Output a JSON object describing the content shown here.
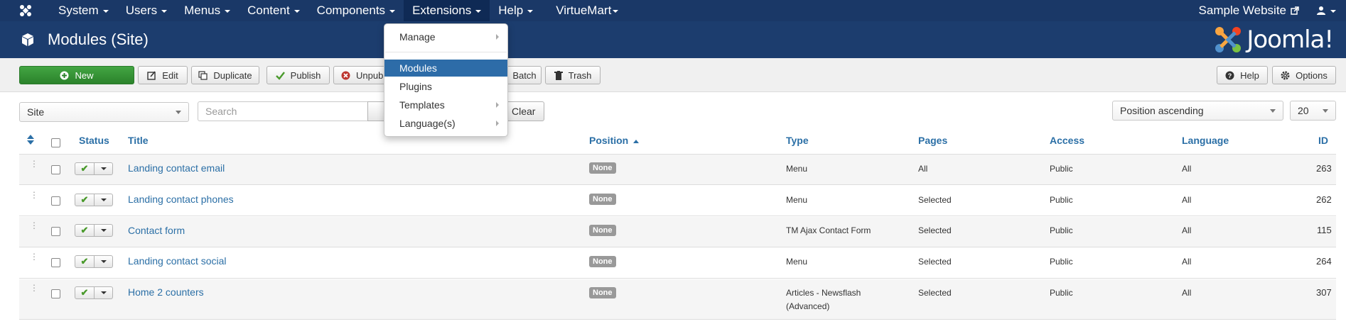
{
  "navbar": {
    "items": [
      {
        "label": "System",
        "has_caret": true
      },
      {
        "label": "Users",
        "has_caret": true
      },
      {
        "label": "Menus",
        "has_caret": true
      },
      {
        "label": "Content",
        "has_caret": true
      },
      {
        "label": "Components",
        "has_caret": true
      },
      {
        "label": "Extensions",
        "has_caret": true
      },
      {
        "label": "Help",
        "has_caret": true
      },
      {
        "label": "VirtueMart",
        "has_caret": true
      }
    ],
    "site_link": "Sample Website"
  },
  "header": {
    "title": "Modules (Site)",
    "logo_text": "Joomla!"
  },
  "toolbar": {
    "new_label": "New",
    "edit_label": "Edit",
    "duplicate_label": "Duplicate",
    "publish_label": "Publish",
    "unpublish_label": "Unpubl",
    "batch_label": "Batch",
    "trash_label": "Trash",
    "help_label": "Help",
    "options_label": "Options"
  },
  "filters": {
    "client_select": "Site",
    "search_placeholder": "Search",
    "clear_label": "Clear",
    "sort_select": "Position ascending",
    "limit_select": "20"
  },
  "dropdown": {
    "items": [
      {
        "label": "Manage",
        "has_submenu": true
      },
      {
        "label": "Modules",
        "has_submenu": false,
        "active": true
      },
      {
        "label": "Plugins",
        "has_submenu": false
      },
      {
        "label": "Templates",
        "has_submenu": true
      },
      {
        "label": "Language(s)",
        "has_submenu": true
      }
    ]
  },
  "table": {
    "headers": {
      "status": "Status",
      "title": "Title",
      "position": "Position",
      "type": "Type",
      "pages": "Pages",
      "access": "Access",
      "language": "Language",
      "id": "ID"
    },
    "rows": [
      {
        "title": "Landing contact email",
        "position": "None",
        "type": "Menu",
        "type2": "",
        "pages": "All",
        "access": "Public",
        "language": "All",
        "id": "263"
      },
      {
        "title": "Landing contact phones",
        "position": "None",
        "type": "Menu",
        "type2": "",
        "pages": "Selected",
        "access": "Public",
        "language": "All",
        "id": "262"
      },
      {
        "title": "Contact form",
        "position": "None",
        "type": "TM Ajax Contact Form",
        "type2": "",
        "pages": "Selected",
        "access": "Public",
        "language": "All",
        "id": "115"
      },
      {
        "title": "Landing contact social",
        "position": "None",
        "type": "Menu",
        "type2": "",
        "pages": "Selected",
        "access": "Public",
        "language": "All",
        "id": "264"
      },
      {
        "title": "Home 2 counters",
        "position": "None",
        "type": "Articles - Newsflash",
        "type2": "(Advanced)",
        "pages": "Selected",
        "access": "Public",
        "language": "All",
        "id": "307"
      }
    ]
  },
  "colors": {
    "navbar": "#1a3867",
    "header": "#1c3d6e",
    "link": "#2b6fa6",
    "new_button": "#2f8b2f",
    "active_menu": "#2d6ca8"
  }
}
